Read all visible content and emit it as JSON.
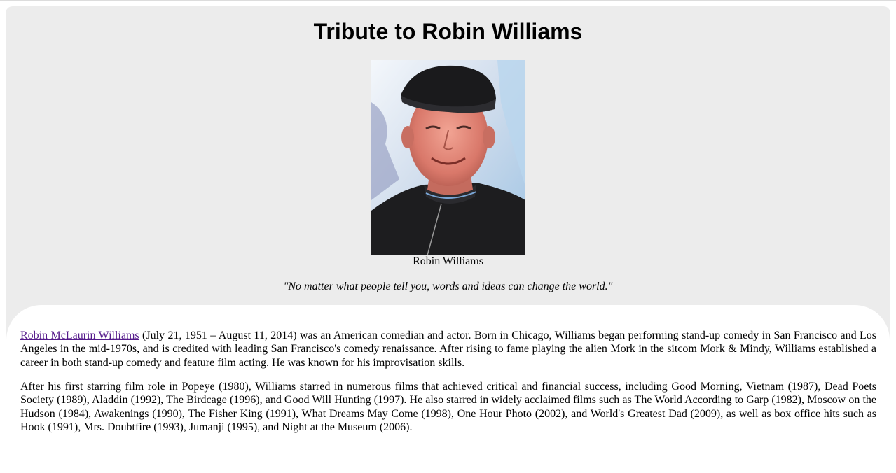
{
  "page": {
    "title": "Tribute to Robin Williams",
    "image_caption": "Robin Williams",
    "quote": "\"No matter what people tell you, words and ideas can change the world.\""
  },
  "bio": {
    "link_text": "Robin McLaurin Williams",
    "paragraph1_rest": " (July 21, 1951 – August 11, 2014) was an American comedian and actor. Born in Chicago, Williams began performing stand-up comedy in San Francisco and Los Angeles in the mid-1970s, and is credited with leading San Francisco's comedy renaissance. After rising to fame playing the alien Mork in the sitcom Mork & Mindy, Williams established a career in both stand-up comedy and feature film acting. He was known for his improvisation skills.",
    "paragraph2": "After his first starring film role in Popeye (1980), Williams starred in numerous films that achieved critical and financial success, including Good Morning, Vietnam (1987), Dead Poets Society (1989), Aladdin (1992), The Birdcage (1996), and Good Will Hunting (1997). He also starred in widely acclaimed films such as The World According to Garp (1982), Moscow on the Hudson (1984), Awakenings (1990), The Fisher King (1991), What Dreams May Come (1998), One Hour Photo (2002), and World's Greatest Dad (2009), as well as box office hits such as Hook (1991), Mrs. Doubtfire (1993), Jumanji (1995), and Night at the Museum (2006)."
  },
  "colors": {
    "page_background": "#ececec",
    "card_background": "#ffffff",
    "link_visited": "#551a8b"
  }
}
